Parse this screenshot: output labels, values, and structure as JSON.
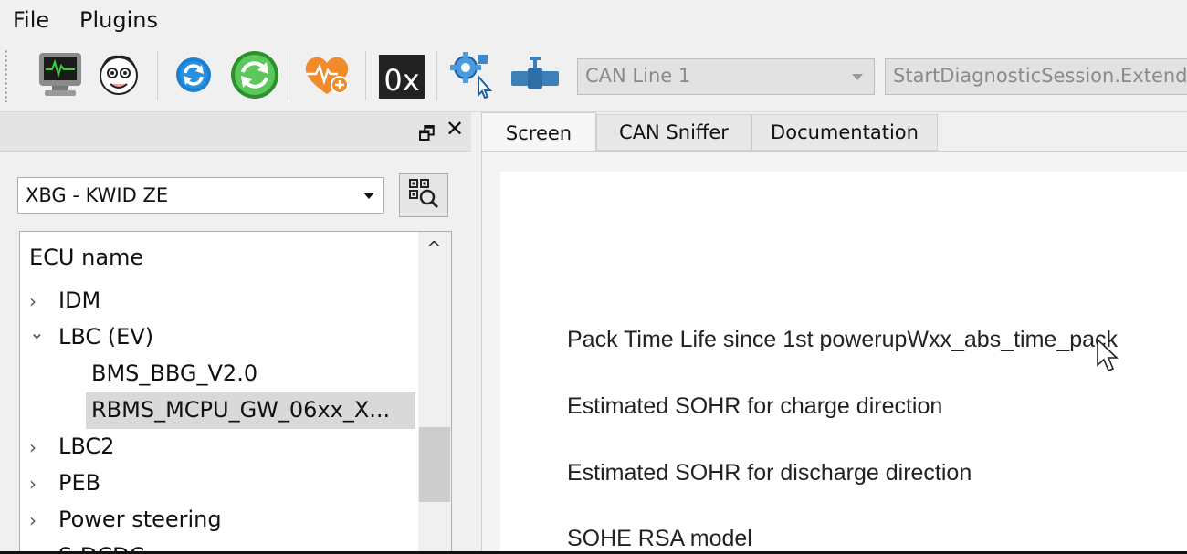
{
  "menu": {
    "file_label": "File",
    "plugins_label": "Plugins"
  },
  "toolbar": {
    "buttons": [
      {
        "icon": "monitor-icon"
      },
      {
        "icon": "face-icon"
      },
      {
        "icon": "refresh-blue-icon"
      },
      {
        "icon": "refresh-green-icon"
      },
      {
        "icon": "heart-plus-icon"
      },
      {
        "icon": "hex-icon",
        "label": "0x"
      },
      {
        "icon": "gear-click-icon"
      },
      {
        "icon": "valve-icon"
      }
    ],
    "can_line": {
      "value": "CAN Line 1"
    },
    "session": {
      "value": "StartDiagnosticSession.Extende"
    }
  },
  "dock": {
    "float_glyph": "🗗",
    "close_glyph": "✕"
  },
  "left": {
    "vehicle": {
      "value": "XBG - KWID ZE"
    },
    "tree": {
      "header": "ECU name",
      "items": [
        {
          "label": "IDM",
          "expanded": false
        },
        {
          "label": "LBC (EV)",
          "expanded": true
        },
        {
          "label": "BMS_BBG_V2.0",
          "child": true
        },
        {
          "label": "RBMS_MCPU_GW_06xx_X...",
          "child": true,
          "selected": true
        },
        {
          "label": "LBC2",
          "expanded": false
        },
        {
          "label": "PEB",
          "expanded": false
        },
        {
          "label": "Power steering",
          "expanded": false
        },
        {
          "label": "S-DCDC",
          "expanded": false
        }
      ],
      "chevron_collapsed": "›",
      "chevron_expanded": "⌄",
      "scroll_up": "^"
    }
  },
  "tabs": [
    {
      "label": "Screen",
      "active": true
    },
    {
      "label": "CAN Sniffer",
      "active": false
    },
    {
      "label": "Documentation",
      "active": false
    }
  ],
  "screen": {
    "params": [
      "Pack Time Life since 1st powerupWxx_abs_time_pack",
      "Estimated SOHR for charge direction",
      "Estimated SOHR for discharge direction",
      "SOHE RSA model"
    ]
  },
  "colors": {
    "accent_green": "#3cae3c",
    "accent_blue": "#1e7fd1",
    "heart_orange": "#f08a2a"
  }
}
